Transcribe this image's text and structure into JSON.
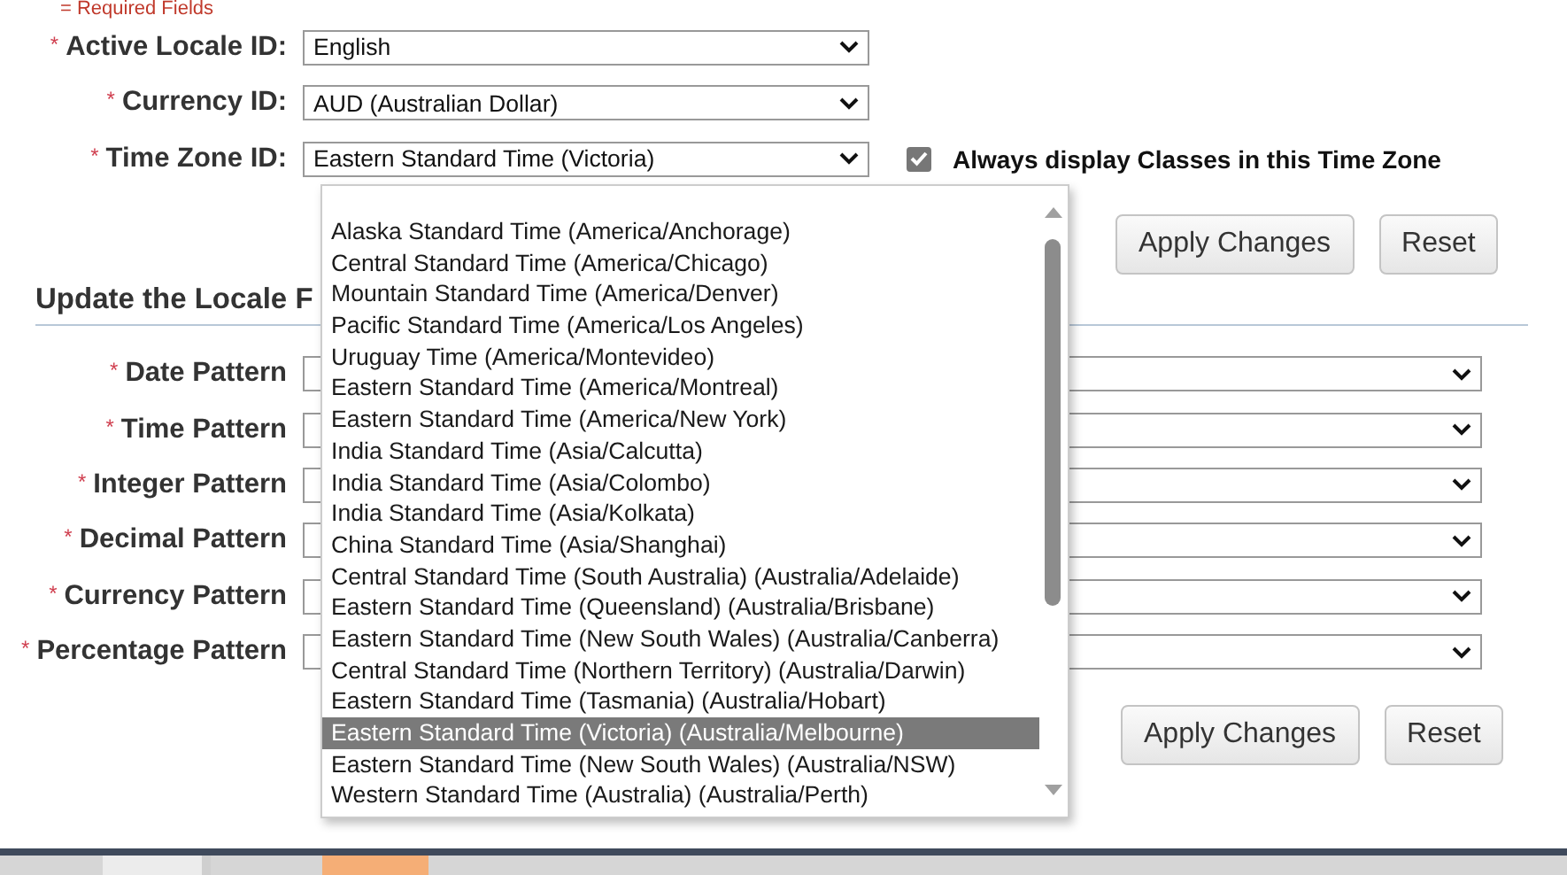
{
  "required_note": "= Required Fields",
  "locale_fields": [
    {
      "marker": "*",
      "label": "Active Locale ID:",
      "value": "English"
    },
    {
      "marker": "*",
      "label": "Currency ID:",
      "value": "AUD (Australian Dollar)"
    },
    {
      "marker": "*",
      "label": "Time Zone ID:",
      "value": "Eastern Standard Time (Victoria)"
    }
  ],
  "timezone_option": {
    "label": "Always display Classes in this Time Zone",
    "checked": true
  },
  "buttons": [
    "Apply Changes",
    "Reset"
  ],
  "pattern_section": {
    "title": "Update the Locale F",
    "fields": [
      {
        "marker": "*",
        "label": "Date Pattern"
      },
      {
        "marker": "*",
        "label": "Time Pattern"
      },
      {
        "marker": "*",
        "label": "Integer Pattern"
      },
      {
        "marker": "*",
        "label": "Decimal Pattern"
      },
      {
        "marker": "*",
        "label": "Currency Pattern"
      },
      {
        "marker": "*",
        "label": "Percentage Pattern"
      }
    ],
    "buttons": [
      "Apply Changes",
      "Reset"
    ]
  },
  "timezone_dropdown": {
    "options": [
      {
        "label": "Alaska Standard Time (America/Anchorage)",
        "selected": false
      },
      {
        "label": "Central Standard Time (America/Chicago)",
        "selected": false
      },
      {
        "label": "Mountain Standard Time (America/Denver)",
        "selected": false
      },
      {
        "label": "Pacific Standard Time (America/Los Angeles)",
        "selected": false
      },
      {
        "label": "Uruguay Time (America/Montevideo)",
        "selected": false
      },
      {
        "label": "Eastern Standard Time (America/Montreal)",
        "selected": false
      },
      {
        "label": "Eastern Standard Time (America/New York)",
        "selected": false
      },
      {
        "label": "India Standard Time (Asia/Calcutta)",
        "selected": false
      },
      {
        "label": "India Standard Time (Asia/Colombo)",
        "selected": false
      },
      {
        "label": "India Standard Time (Asia/Kolkata)",
        "selected": false
      },
      {
        "label": "China Standard Time (Asia/Shanghai)",
        "selected": false
      },
      {
        "label": "Central Standard Time (South Australia) (Australia/Adelaide)",
        "selected": false
      },
      {
        "label": "Eastern Standard Time (Queensland) (Australia/Brisbane)",
        "selected": false
      },
      {
        "label": "Eastern Standard Time (New South Wales) (Australia/Canberra)",
        "selected": false
      },
      {
        "label": "Central Standard Time (Northern Territory) (Australia/Darwin)",
        "selected": false
      },
      {
        "label": "Eastern Standard Time (Tasmania) (Australia/Hobart)",
        "selected": false
      },
      {
        "label": "Eastern Standard Time (Victoria) (Australia/Melbourne)",
        "selected": true
      },
      {
        "label": "Eastern Standard Time (New South Wales) (Australia/NSW)",
        "selected": false
      },
      {
        "label": "Western Standard Time (Australia) (Australia/Perth)",
        "selected": false
      }
    ]
  }
}
